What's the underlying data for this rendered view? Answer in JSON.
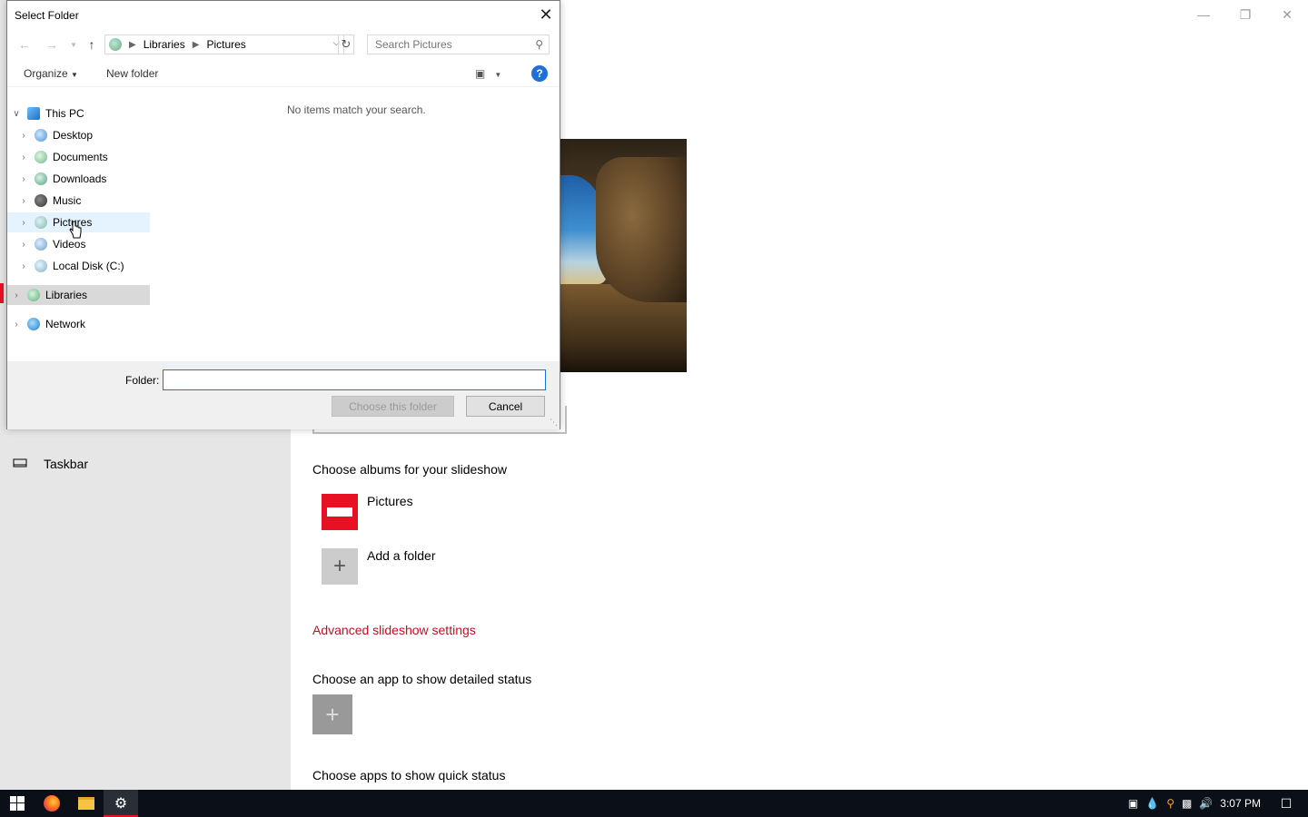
{
  "settings": {
    "nav_taskbar": "Taskbar",
    "albums_title": "Choose albums for your slideshow",
    "album_pictures": "Pictures",
    "album_add": "Add a folder",
    "advanced_link": "Advanced slideshow settings",
    "detailed_status_title": "Choose an app to show detailed status",
    "quick_status_title": "Choose apps to show quick status",
    "accent_color": "#e81123"
  },
  "dialog": {
    "title": "Select Folder",
    "address": {
      "root": "Libraries",
      "current": "Pictures"
    },
    "search_placeholder": "Search Pictures",
    "toolbar": {
      "organize": "Organize",
      "new_folder": "New folder"
    },
    "tree": [
      {
        "label": "This PC",
        "icon": "pc-icon"
      },
      {
        "label": "Desktop",
        "icon": "desktop-icon"
      },
      {
        "label": "Documents",
        "icon": "documents-icon"
      },
      {
        "label": "Downloads",
        "icon": "downloads-icon"
      },
      {
        "label": "Music",
        "icon": "music-icon"
      },
      {
        "label": "Pictures",
        "icon": "pictures-icon"
      },
      {
        "label": "Videos",
        "icon": "videos-icon"
      },
      {
        "label": "Local Disk (C:)",
        "icon": "disk-icon"
      },
      {
        "label": "Libraries",
        "icon": "libraries-icon"
      },
      {
        "label": "Network",
        "icon": "network-icon"
      }
    ],
    "empty_message": "No items match your search.",
    "folder_label": "Folder:",
    "folder_value": "",
    "choose_button": "Choose this folder",
    "cancel_button": "Cancel"
  },
  "taskbar": {
    "clock": "3:07 PM"
  }
}
